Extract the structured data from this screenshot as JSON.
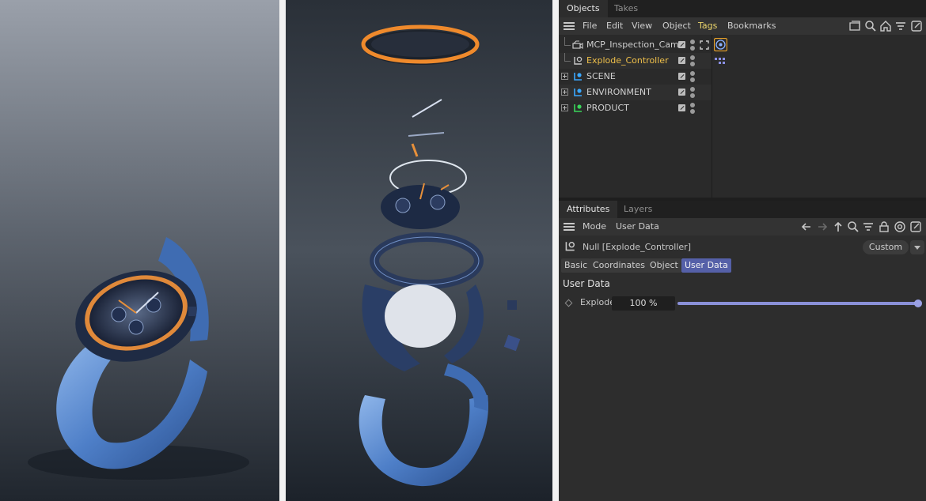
{
  "objects_panel": {
    "tabs": [
      {
        "label": "Objects"
      },
      {
        "label": "Takes"
      }
    ],
    "menu": [
      "File",
      "Edit",
      "View",
      "Object",
      "Tags",
      "Bookmarks"
    ],
    "toolbar_icons": [
      "folder-icon",
      "search-icon",
      "home-icon",
      "filter-icon",
      "new-window-icon"
    ],
    "tree": [
      {
        "name": "MCP_Inspection_Cam",
        "icon": "camera-icon",
        "tag": "focus-target-tag-icon"
      },
      {
        "name": "Explode_Controller",
        "icon": "null-icon",
        "tag": "user-data-tag-icon",
        "selected": true
      },
      {
        "name": "SCENE",
        "icon": "null-icon",
        "expandable": true,
        "icon_color": "#3aa8ff"
      },
      {
        "name": "ENVIRONMENT",
        "icon": "null-icon",
        "expandable": true,
        "icon_color": "#3aa8ff"
      },
      {
        "name": "PRODUCT",
        "icon": "null-icon",
        "expandable": true,
        "icon_color": "#3ad65a"
      }
    ]
  },
  "attributes_panel": {
    "tabs": [
      {
        "label": "Attributes"
      },
      {
        "label": "Layers"
      }
    ],
    "menu": [
      "Mode",
      "User Data"
    ],
    "toolbar_icons": [
      "back-arrow-icon",
      "forward-arrow-icon",
      "up-arrow-icon",
      "search-icon",
      "filter-icon",
      "lock-icon",
      "target-icon",
      "new-window-icon"
    ],
    "object_title": "Null [Explode_Controller]",
    "preset": "Custom",
    "subtabs": [
      {
        "label": "Basic"
      },
      {
        "label": "Coordinates"
      },
      {
        "label": "Object"
      },
      {
        "label": "User Data",
        "active": true
      }
    ],
    "group_title": "User Data",
    "param": {
      "label": "Explode",
      "value": "100 %",
      "level": 1.0
    }
  },
  "colors": {
    "accent": "#5560a8",
    "selected_name": "#f0c04a",
    "slider": "#8a90d8",
    "tag_ring": "#e8a22a"
  }
}
